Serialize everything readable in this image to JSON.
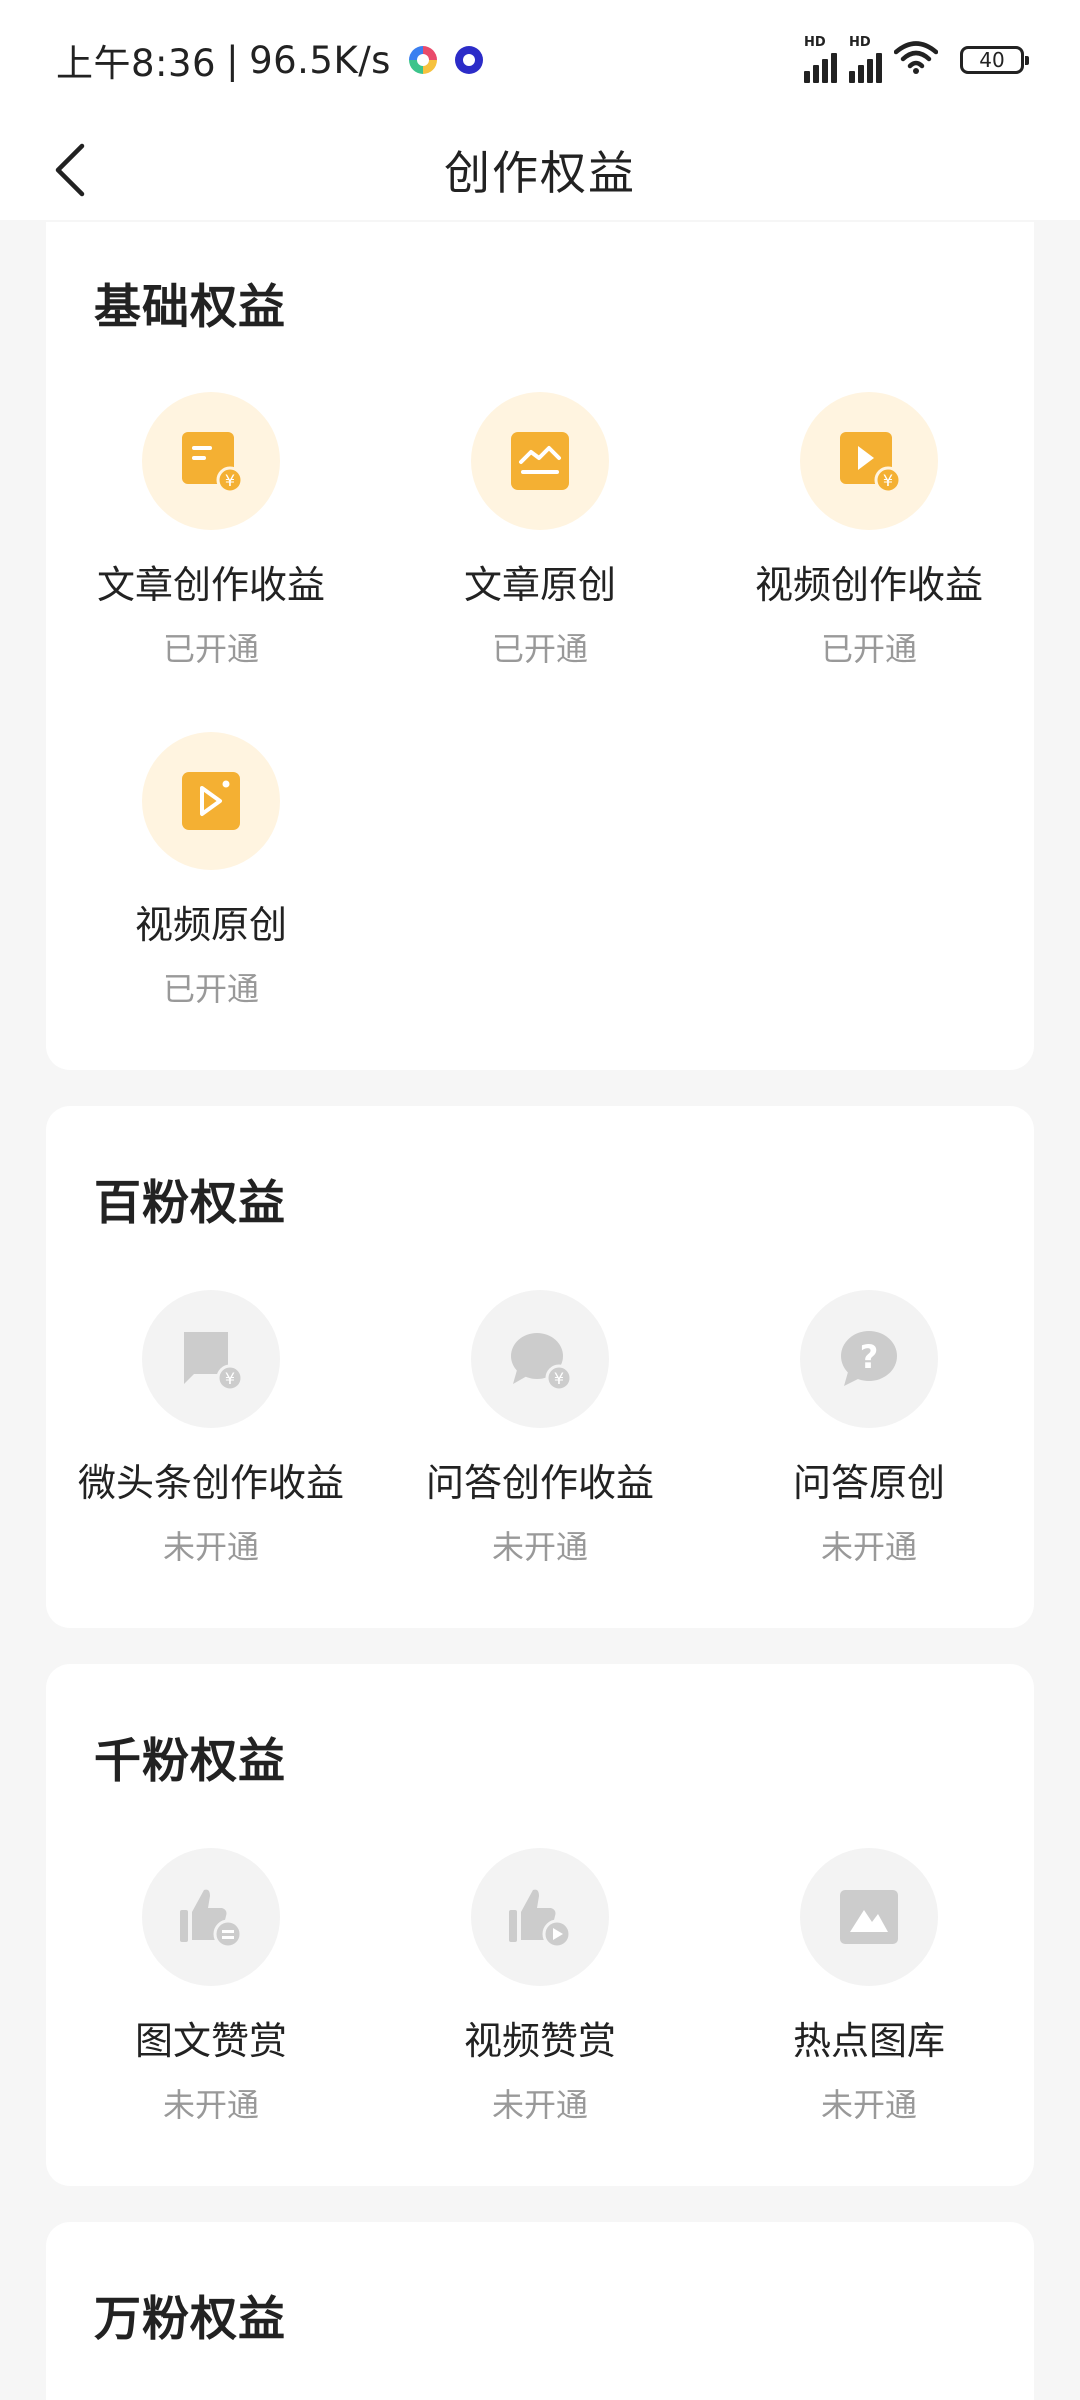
{
  "status_bar": {
    "time": "上午8:36",
    "separator": "|",
    "network_speed": "96.5K/s",
    "signal_badge_1": "HD",
    "signal_badge_2": "HD",
    "battery": "40"
  },
  "nav": {
    "title": "创作权益"
  },
  "colors": {
    "active_icon_bg": "#fff4e0",
    "active_icon": "#f4b033",
    "inactive_icon_bg": "#f3f3f3",
    "inactive_icon": "#cccccc"
  },
  "sections": [
    {
      "title": "基础权益",
      "items": [
        {
          "label": "文章创作收益",
          "status": "已开通",
          "icon": "article-income-icon"
        },
        {
          "label": "文章原创",
          "status": "已开通",
          "icon": "article-original-icon"
        },
        {
          "label": "视频创作收益",
          "status": "已开通",
          "icon": "video-income-icon"
        },
        {
          "label": "视频原创",
          "status": "已开通",
          "icon": "video-original-icon"
        }
      ]
    },
    {
      "title": "百粉权益",
      "items": [
        {
          "label": "微头条创作收益",
          "status": "未开通",
          "icon": "micro-post-income-icon"
        },
        {
          "label": "问答创作收益",
          "status": "未开通",
          "icon": "qa-income-icon"
        },
        {
          "label": "问答原创",
          "status": "未开通",
          "icon": "qa-original-icon"
        }
      ]
    },
    {
      "title": "千粉权益",
      "items": [
        {
          "label": "图文赞赏",
          "status": "未开通",
          "icon": "article-tip-icon"
        },
        {
          "label": "视频赞赏",
          "status": "未开通",
          "icon": "video-tip-icon"
        },
        {
          "label": "热点图库",
          "status": "未开通",
          "icon": "hot-gallery-icon"
        }
      ]
    },
    {
      "title": "万粉权益",
      "items": []
    }
  ]
}
